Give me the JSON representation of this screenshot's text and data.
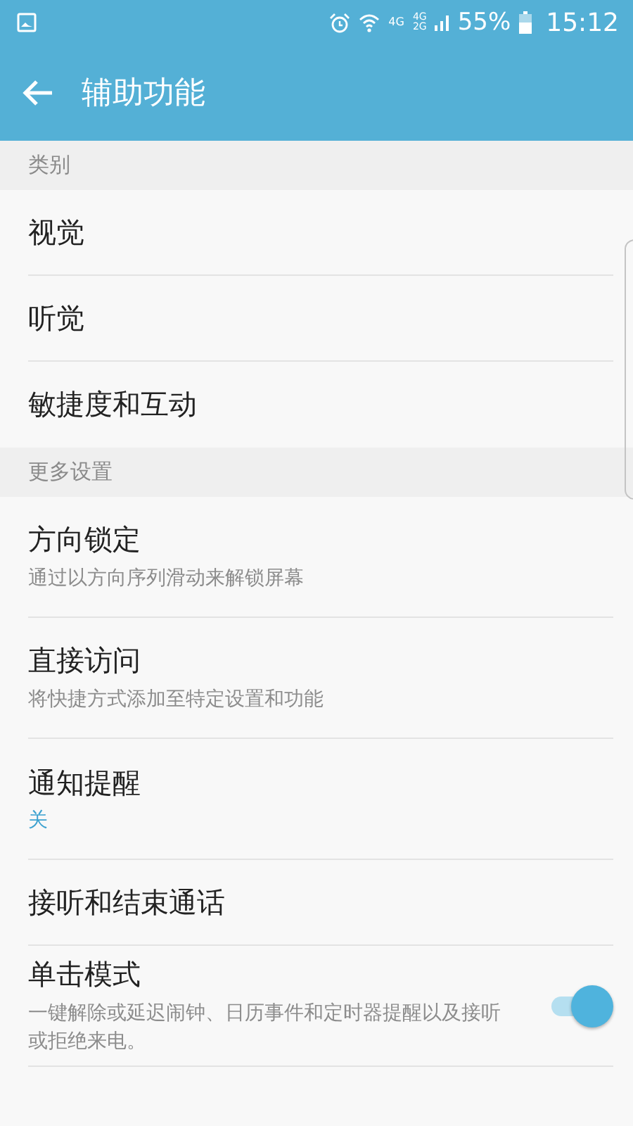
{
  "status_bar": {
    "network_1": "4G",
    "network_2_top": "4G",
    "network_2_bottom": "2G",
    "battery": "55%",
    "time": "15:12"
  },
  "app_bar": {
    "title": "辅助功能"
  },
  "sections": [
    {
      "header": "类别",
      "items": [
        {
          "kind": "plain",
          "title": "视觉"
        },
        {
          "kind": "plain",
          "title": "听觉"
        },
        {
          "kind": "plain",
          "title": "敏捷度和互动"
        }
      ]
    },
    {
      "header": "更多设置",
      "items": [
        {
          "kind": "subtitle",
          "title": "方向锁定",
          "subtitle": "通过以方向序列滑动来解锁屏幕"
        },
        {
          "kind": "subtitle",
          "title": "直接访问",
          "subtitle": "将快捷方式添加至特定设置和功能"
        },
        {
          "kind": "value",
          "title": "通知提醒",
          "value": "关"
        },
        {
          "kind": "plain",
          "title": "接听和结束通话"
        },
        {
          "kind": "switch",
          "title": "单击模式",
          "subtitle": "一键解除或延迟闹钟、日历事件和定时器提醒以及接听或拒绝来电。",
          "on": true
        }
      ]
    }
  ]
}
